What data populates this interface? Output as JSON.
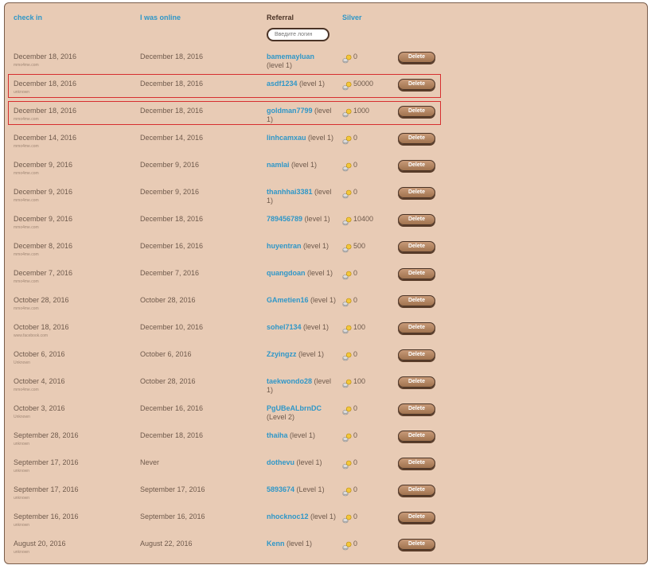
{
  "headers": {
    "checkin": "check in",
    "online": "I was online",
    "referral": "Referral",
    "silver": "Silver"
  },
  "search": {
    "placeholder": "Введите логин",
    "value": ""
  },
  "delete_label": "Delete",
  "highlighted_rows": [
    1,
    2
  ],
  "rows": [
    {
      "checkin": "December 18, 2016",
      "source": "mmo4me.com",
      "online": "December 18, 2016",
      "name": "bamemayluan",
      "level": "(level 1)",
      "silver": "0"
    },
    {
      "checkin": "December 18, 2016",
      "source": "unknown",
      "online": "December 18, 2016",
      "name": "asdf1234",
      "level": "(level 1)",
      "silver": "50000"
    },
    {
      "checkin": "December 18, 2016",
      "source": "mmo4me.com",
      "online": "December 18, 2016",
      "name": "goldman7799",
      "level": "(level 1)",
      "silver": "1000"
    },
    {
      "checkin": "December 14, 2016",
      "source": "mmo4me.com",
      "online": "December 14, 2016",
      "name": "linhcamxau",
      "level": "(level 1)",
      "silver": "0"
    },
    {
      "checkin": "December 9, 2016",
      "source": "mmo4me.com",
      "online": "December 9, 2016",
      "name": "namlai",
      "level": "(level 1)",
      "silver": "0"
    },
    {
      "checkin": "December 9, 2016",
      "source": "mmo4me.com",
      "online": "December 9, 2016",
      "name": "thanhhai3381",
      "level": "(level 1)",
      "silver": "0"
    },
    {
      "checkin": "December 9, 2016",
      "source": "mmo4me.com",
      "online": "December 18, 2016",
      "name": "789456789",
      "level": "(level 1)",
      "silver": "10400"
    },
    {
      "checkin": "December 8, 2016",
      "source": "mmo4me.com",
      "online": "December 16, 2016",
      "name": "huyentran",
      "level": "(level 1)",
      "silver": "500"
    },
    {
      "checkin": "December 7, 2016",
      "source": "mmo4me.com",
      "online": "December 7, 2016",
      "name": "quangdoan",
      "level": "(level 1)",
      "silver": "0"
    },
    {
      "checkin": "October 28, 2016",
      "source": "mmo4me.com",
      "online": "October 28, 2016",
      "name": "GAmetien16",
      "level": "(level 1)",
      "silver": "0"
    },
    {
      "checkin": "October 18, 2016",
      "source": "www.facebook.com",
      "online": "December 10, 2016",
      "name": "sohel7134",
      "level": "(level 1)",
      "silver": "100"
    },
    {
      "checkin": "October 6, 2016",
      "source": "Unknown",
      "online": "October 6, 2016",
      "name": "Zzyingzz",
      "level": "(level 1)",
      "silver": "0"
    },
    {
      "checkin": "October 4, 2016",
      "source": "mmo4me.com",
      "online": "October 28, 2016",
      "name": "taekwondo28",
      "level": "(level 1)",
      "silver": "100"
    },
    {
      "checkin": "October 3, 2016",
      "source": "Unknown",
      "online": "December 16, 2016",
      "name": "PgUBeALbrnDC",
      "level": "(Level 2)",
      "silver": "0"
    },
    {
      "checkin": "September 28, 2016",
      "source": "unknown",
      "online": "December 18, 2016",
      "name": "thaiha",
      "level": "(level 1)",
      "silver": "0"
    },
    {
      "checkin": "September 17, 2016",
      "source": "unknown",
      "online": "Never",
      "name": "dothevu",
      "level": "(level 1)",
      "silver": "0"
    },
    {
      "checkin": "September 17, 2016",
      "source": "unknown",
      "online": "September 17, 2016",
      "name": "5893674",
      "level": "(Level 1)",
      "silver": "0"
    },
    {
      "checkin": "September 16, 2016",
      "source": "unknown",
      "online": "September 16, 2016",
      "name": "nhocknoc12",
      "level": "(level 1)",
      "silver": "0"
    },
    {
      "checkin": "August 20, 2016",
      "source": "unknown",
      "online": "August 22, 2016",
      "name": "Kenn",
      "level": "(level 1)",
      "silver": "0"
    }
  ]
}
